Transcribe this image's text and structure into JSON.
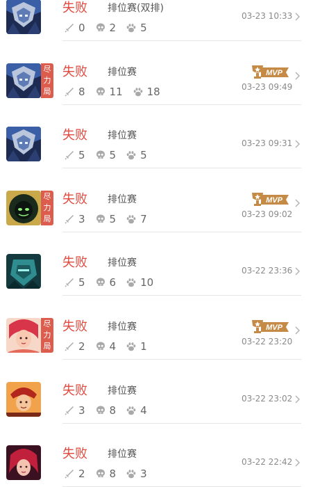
{
  "match_list": {
    "items": [
      {
        "result": "失败",
        "mode": "排位赛(双排)",
        "kills": "0",
        "deaths": "2",
        "assists": "5",
        "time": "03-23 10:33",
        "effort_tag": "",
        "mvp": false,
        "hero": "blue-armor-hero"
      },
      {
        "result": "失败",
        "mode": "排位赛",
        "kills": "8",
        "deaths": "11",
        "assists": "18",
        "time": "03-23 09:49",
        "effort_tag": "尽力局",
        "mvp": true,
        "hero": "blue-armor-hero"
      },
      {
        "result": "失败",
        "mode": "排位赛",
        "kills": "5",
        "deaths": "5",
        "assists": "5",
        "time": "03-23 09:31",
        "effort_tag": "",
        "mvp": false,
        "hero": "blue-armor-hero"
      },
      {
        "result": "失败",
        "mode": "排位赛",
        "kills": "3",
        "deaths": "5",
        "assists": "7",
        "time": "03-23 09:02",
        "effort_tag": "尽力局",
        "mvp": true,
        "hero": "green-hooded-hero"
      },
      {
        "result": "失败",
        "mode": "排位赛",
        "kills": "5",
        "deaths": "6",
        "assists": "10",
        "time": "03-22 23:36",
        "effort_tag": "",
        "mvp": false,
        "hero": "teal-mech-hero"
      },
      {
        "result": "失败",
        "mode": "排位赛",
        "kills": "2",
        "deaths": "4",
        "assists": "1",
        "time": "03-22 23:20",
        "effort_tag": "尽力局",
        "mvp": true,
        "hero": "red-hair-heroine"
      },
      {
        "result": "失败",
        "mode": "排位赛",
        "kills": "3",
        "deaths": "8",
        "assists": "4",
        "time": "03-22 23:02",
        "effort_tag": "",
        "mvp": false,
        "hero": "red-hair-boy-hero"
      },
      {
        "result": "失败",
        "mode": "排位赛",
        "kills": "2",
        "deaths": "8",
        "assists": "3",
        "time": "03-22 22:42",
        "effort_tag": "",
        "mvp": false,
        "hero": "crimson-hair-heroine"
      }
    ],
    "mvp_label": "MVP",
    "icons": {
      "kills": "sword-icon",
      "deaths": "skull-icon",
      "assists": "paw-icon",
      "more": "chevron-right-icon"
    },
    "colors": {
      "result": "#e14a3f",
      "effort_tag": "#dc5c4e",
      "mvp_badge": "#c58a45",
      "secondary_text": "#8a8a8a"
    }
  }
}
